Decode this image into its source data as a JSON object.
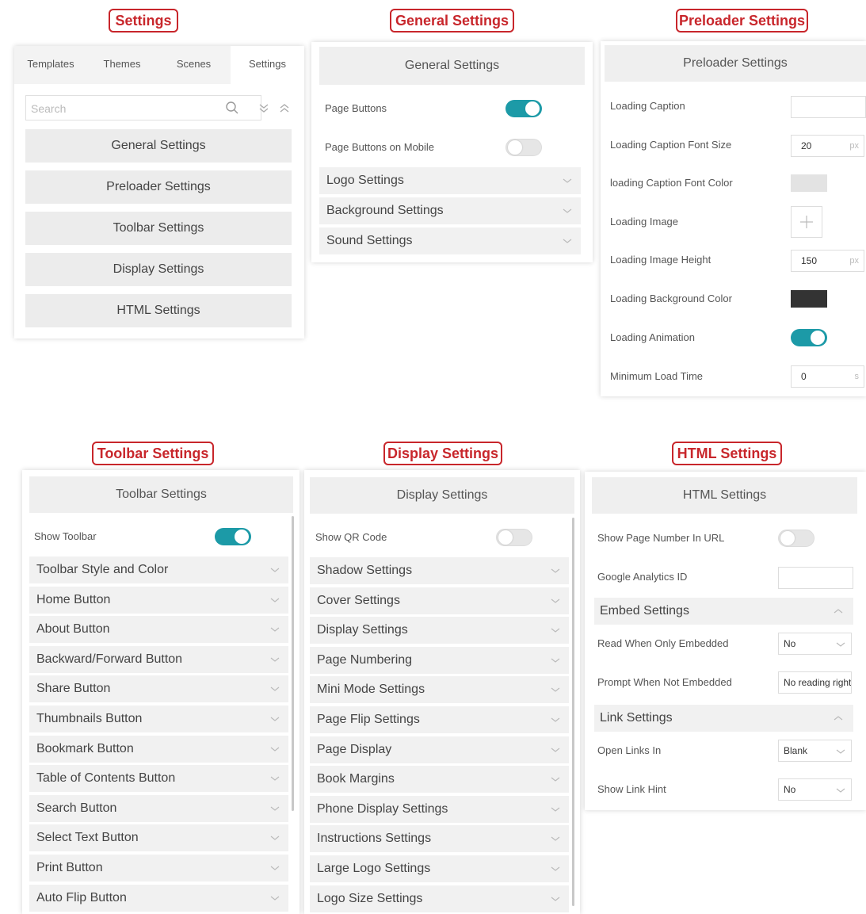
{
  "callouts": {
    "settings": "Settings",
    "general": "General Settings",
    "preloader": "Preloader Settings",
    "toolbar": "Toolbar Settings",
    "display": "Display Settings",
    "html": "HTML Settings"
  },
  "settings_panel": {
    "tabs": [
      "Templates",
      "Themes",
      "Scenes",
      "Settings"
    ],
    "active_tab": "Settings",
    "search_placeholder": "Search",
    "items": [
      "General Settings",
      "Preloader Settings",
      "Toolbar Settings",
      "Display Settings",
      "HTML Settings"
    ]
  },
  "general_panel": {
    "title": "General Settings",
    "toggles": [
      {
        "label": "Page Buttons",
        "on": true
      },
      {
        "label": "Page Buttons on Mobile",
        "on": false
      }
    ],
    "sections": [
      "Logo Settings",
      "Background Settings",
      "Sound Settings"
    ]
  },
  "preloader_panel": {
    "title": "Preloader Settings",
    "rows": {
      "caption": {
        "label": "Loading Caption",
        "value": ""
      },
      "caption_size": {
        "label": "Loading Caption Font Size",
        "value": "20",
        "unit": "px"
      },
      "caption_color": {
        "label": "loading Caption Font Color",
        "color": "#e3e3e3"
      },
      "image": {
        "label": "Loading Image"
      },
      "image_height": {
        "label": "Loading Image Height",
        "value": "150",
        "unit": "px"
      },
      "bg_color": {
        "label": "Loading Background Color",
        "color": "#333333"
      },
      "animation": {
        "label": "Loading Animation",
        "on": true
      },
      "min_time": {
        "label": "Minimum Load Time",
        "value": "0",
        "unit": "s"
      }
    }
  },
  "toolbar_panel": {
    "title": "Toolbar Settings",
    "show_toolbar": {
      "label": "Show Toolbar",
      "on": true
    },
    "sections": [
      "Toolbar Style and Color",
      "Home Button",
      "About Button",
      "Backward/Forward Button",
      "Share Button",
      "Thumbnails Button",
      "Bookmark Button",
      "Table of Contents Button",
      "Search Button",
      "Select Text Button",
      "Print Button",
      "Auto Flip Button"
    ]
  },
  "display_panel": {
    "title": "Display Settings",
    "show_qr": {
      "label": "Show QR Code",
      "on": false
    },
    "sections": [
      "Shadow Settings",
      "Cover Settings",
      "Display Settings",
      "Page Numbering",
      "Mini Mode Settings",
      "Page Flip Settings",
      "Page Display",
      "Book Margins",
      "Phone Display Settings",
      "Instructions Settings",
      "Large Logo Settings",
      "Logo Size Settings"
    ]
  },
  "html_panel": {
    "title": "HTML Settings",
    "page_number_url": {
      "label": "Show Page Number In URL",
      "on": false
    },
    "ga": {
      "label": "Google Analytics ID",
      "value": ""
    },
    "embed": {
      "title": "Embed Settings",
      "read_only": {
        "label": "Read When Only Embedded",
        "value": "No"
      },
      "prompt": {
        "label": "Prompt When Not Embedded",
        "value": "No reading rights"
      }
    },
    "links": {
      "title": "Link Settings",
      "open_in": {
        "label": "Open Links In",
        "value": "Blank"
      },
      "hint": {
        "label": "Show Link Hint",
        "value": "No"
      }
    }
  },
  "colors": {
    "accent": "#1c9aa7",
    "callout": "#c8262b"
  }
}
